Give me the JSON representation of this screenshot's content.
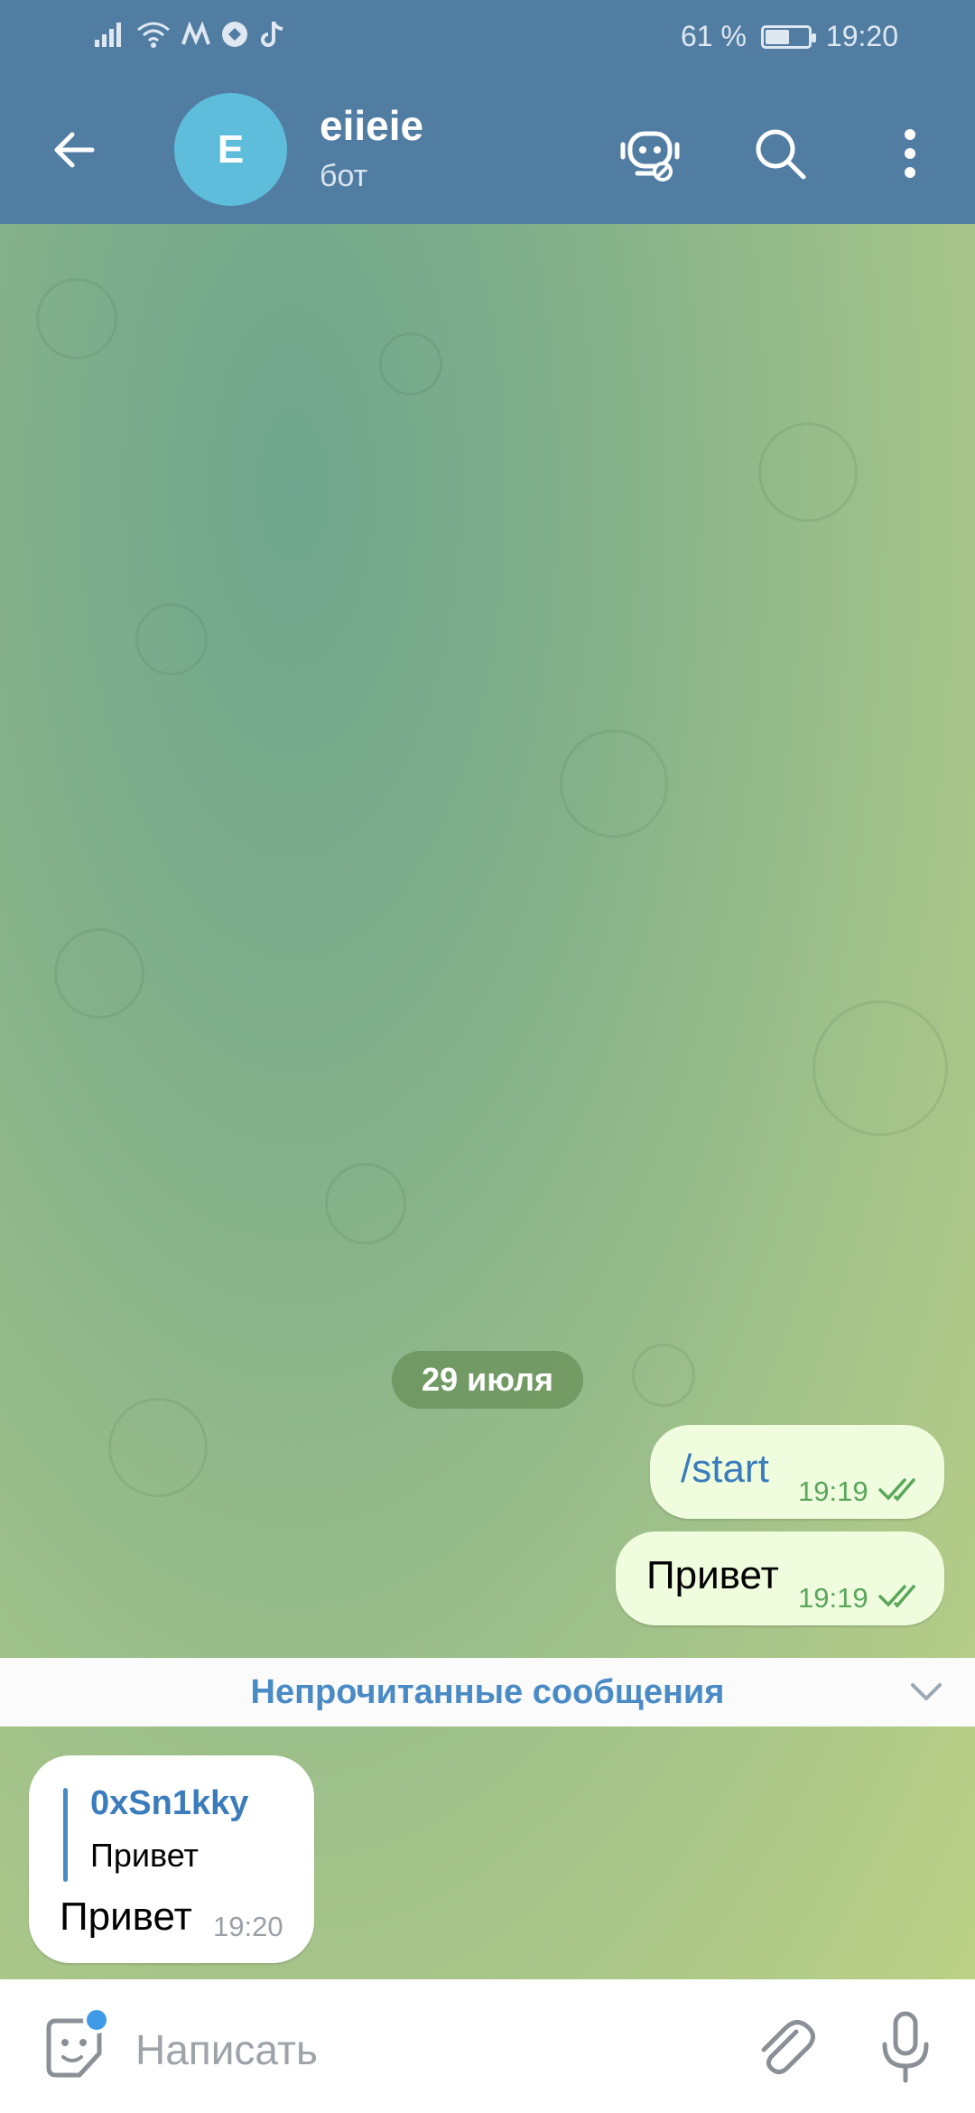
{
  "status_bar": {
    "battery": "61 %",
    "battery_level": 0.61,
    "time": "19:20",
    "icons": [
      "signal-icon",
      "wifi-icon",
      "app-m-icon",
      "vpn-icon",
      "tiktok-icon"
    ]
  },
  "header": {
    "avatar_letter": "E",
    "title": "eiieie",
    "subtitle": "бот",
    "avatar_color": "#5ebddb",
    "bar_color": "#527da3"
  },
  "chat": {
    "date_label": "29 июля",
    "outgoing": [
      {
        "text": "/start",
        "time": "19:19",
        "is_command": true
      },
      {
        "text": "Привет",
        "time": "19:19",
        "is_command": false
      }
    ],
    "unread_label": "Непрочитанные сообщения",
    "incoming": {
      "reply_name": "0xSn1kky",
      "reply_text": "Привет",
      "text": "Привет",
      "time": "19:20"
    }
  },
  "composer": {
    "placeholder": "Написать"
  }
}
